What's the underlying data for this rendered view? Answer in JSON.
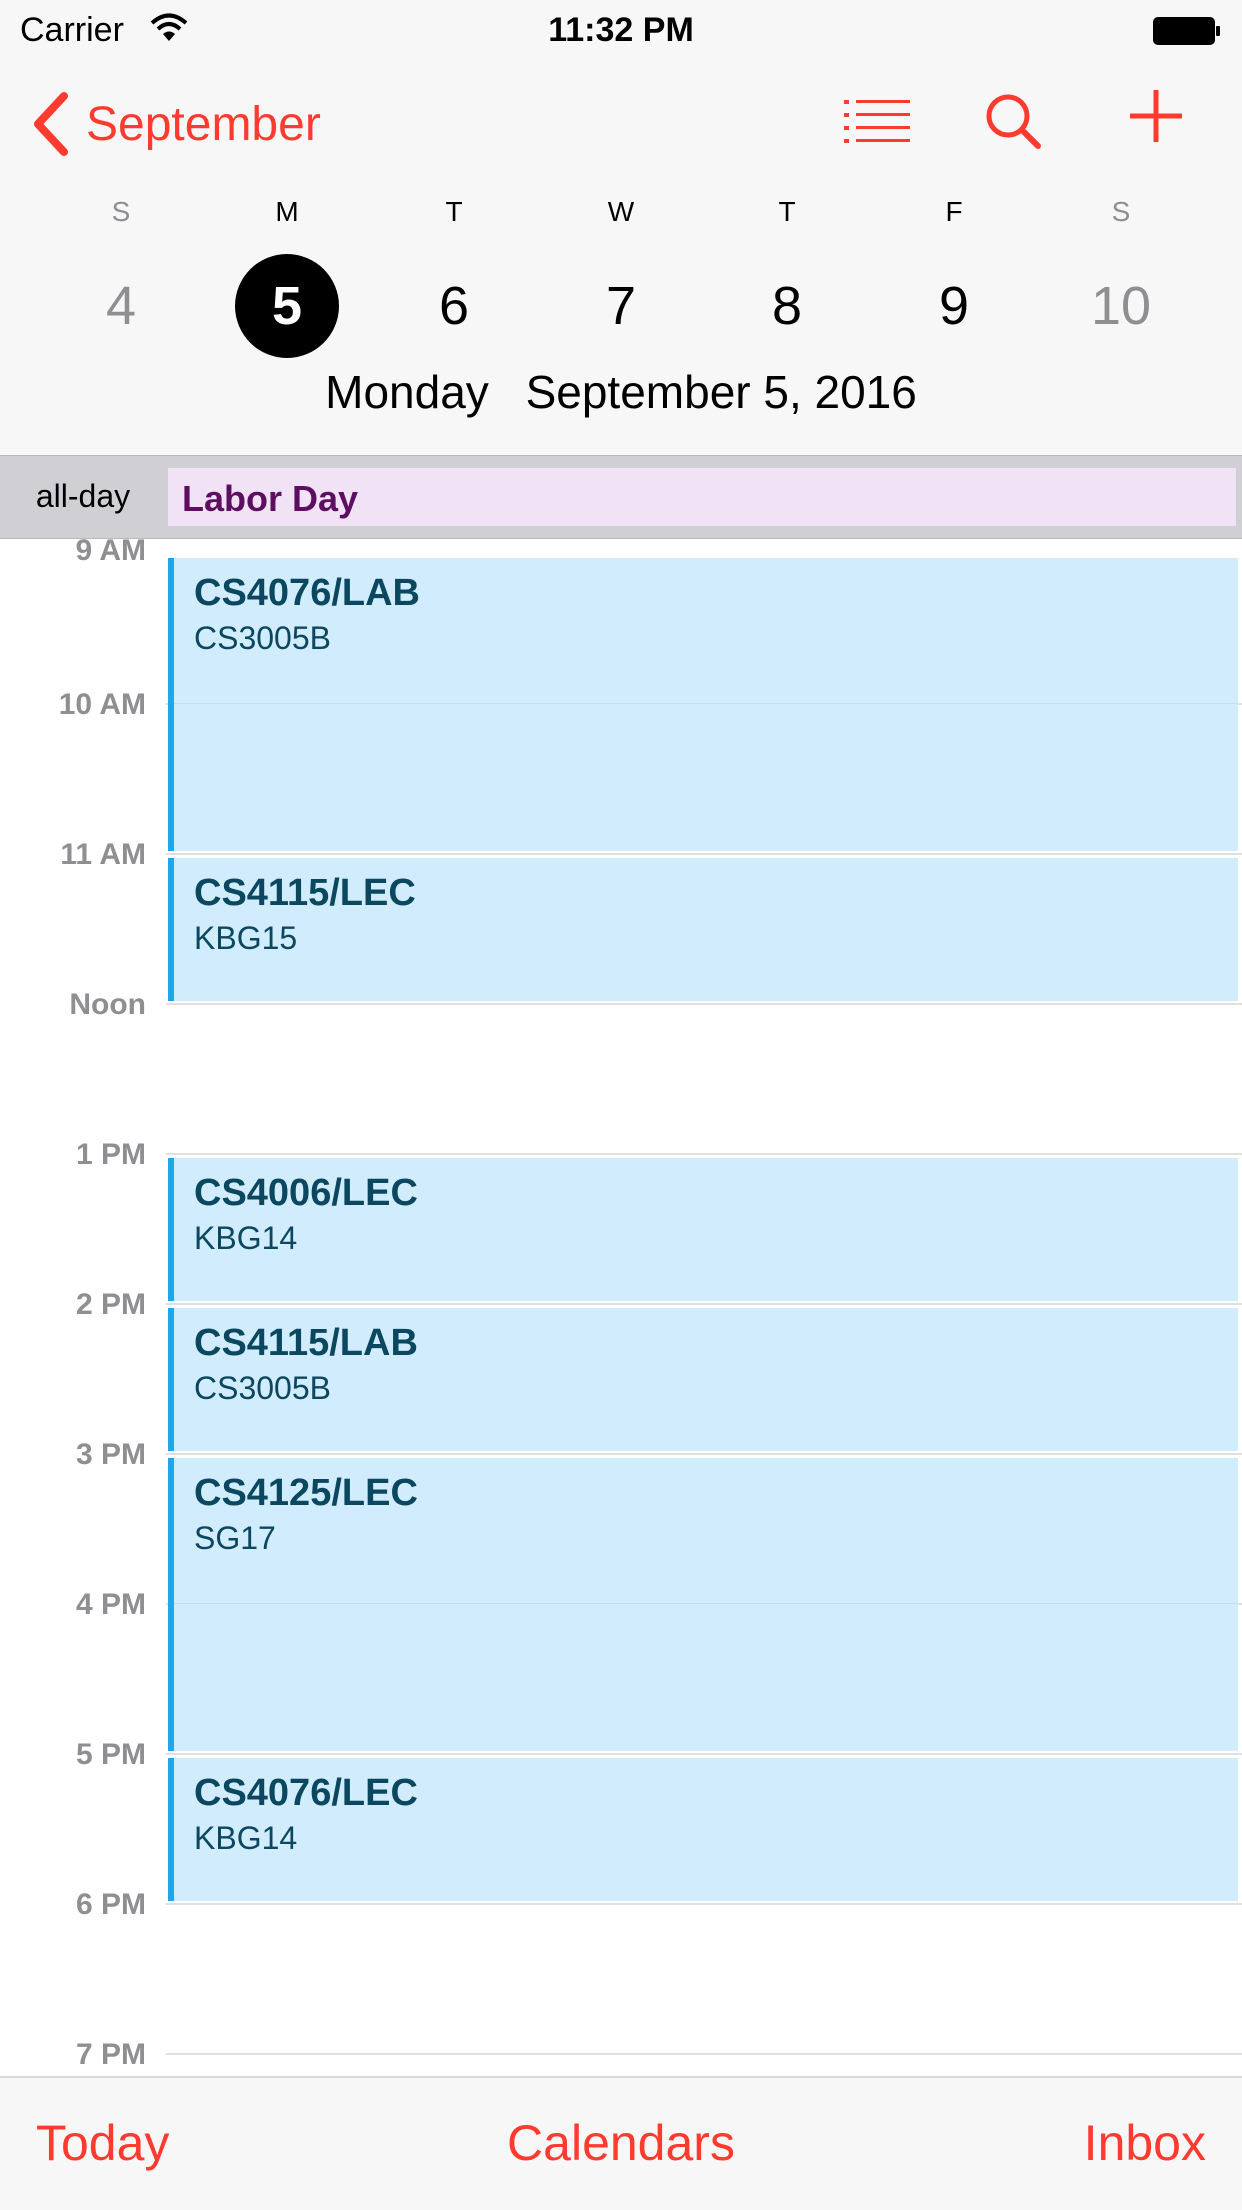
{
  "status_bar": {
    "carrier": "Carrier",
    "time": "11:32 PM"
  },
  "nav": {
    "back_label": "September",
    "icons": [
      "list-icon",
      "search-icon",
      "add-icon"
    ],
    "accent_color": "#ff3b30"
  },
  "week": {
    "days_of_week": [
      "S",
      "M",
      "T",
      "W",
      "T",
      "F",
      "S"
    ],
    "dates": [
      "4",
      "5",
      "6",
      "7",
      "8",
      "9",
      "10"
    ],
    "selected_index": 1
  },
  "full_date": {
    "weekday": "Monday",
    "date": "September 5, 2016"
  },
  "all_day": {
    "label": "all-day",
    "event": "Labor Day",
    "color": "#f2e2f6"
  },
  "hours": [
    "9 AM",
    "10 AM",
    "11 AM",
    "Noon",
    "1 PM",
    "2 PM",
    "3 PM",
    "4 PM",
    "5 PM",
    "6 PM",
    "7 PM"
  ],
  "events": [
    {
      "title": "CS4076/LAB",
      "location": "CS3005B",
      "start": "9 AM",
      "end": "11 AM"
    },
    {
      "title": "CS4115/LEC",
      "location": "KBG15",
      "start": "11 AM",
      "end": "Noon"
    },
    {
      "title": "CS4006/LEC",
      "location": "KBG14",
      "start": "1 PM",
      "end": "2 PM"
    },
    {
      "title": "CS4115/LAB",
      "location": "CS3005B",
      "start": "2 PM",
      "end": "3 PM"
    },
    {
      "title": "CS4125/LEC",
      "location": "SG17",
      "start": "3 PM",
      "end": "5 PM"
    },
    {
      "title": "CS4076/LEC",
      "location": "KBG14",
      "start": "5 PM",
      "end": "6 PM"
    }
  ],
  "tab_bar": {
    "today": "Today",
    "calendars": "Calendars",
    "inbox": "Inbox"
  }
}
